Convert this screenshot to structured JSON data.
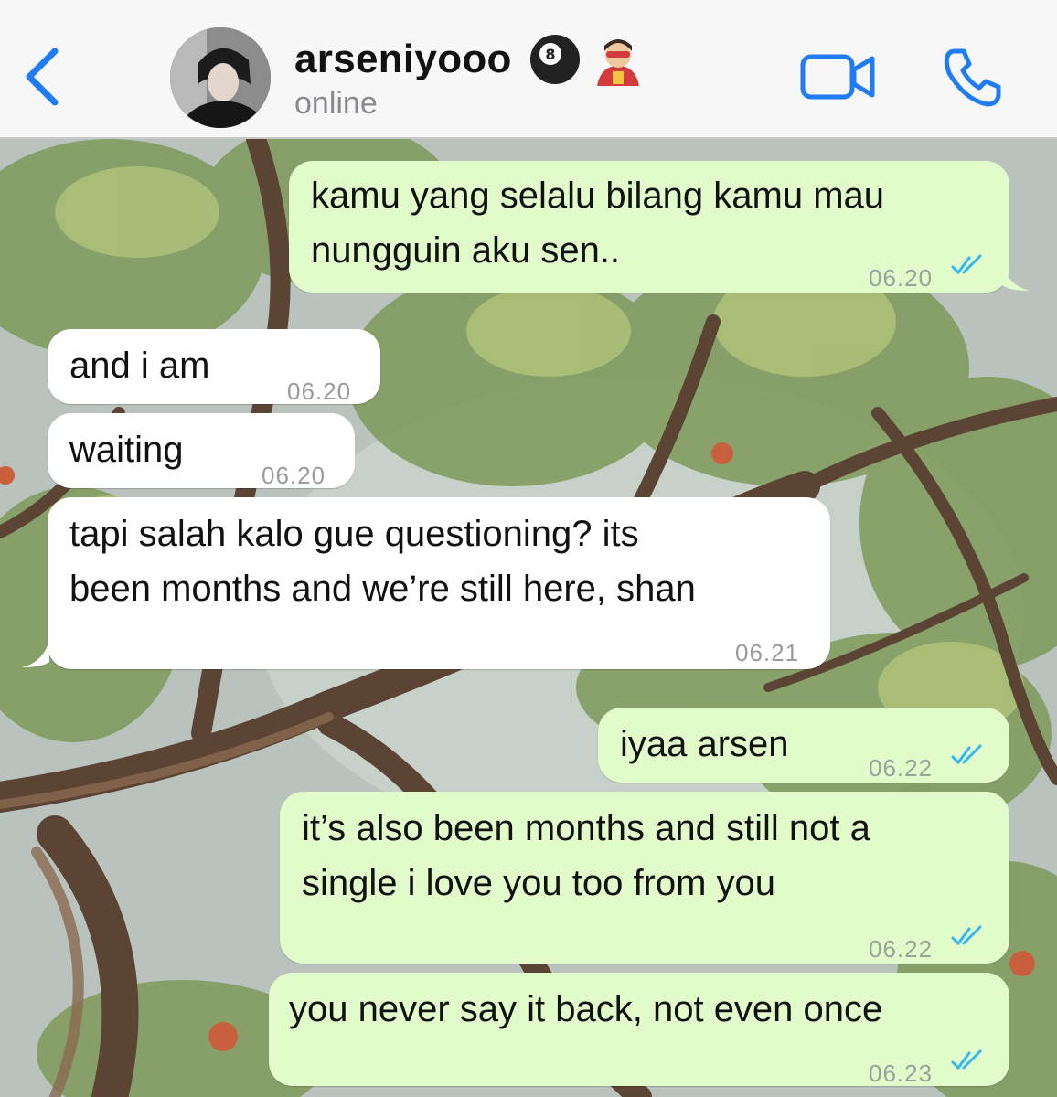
{
  "header": {
    "contact_name": "arseniyooo",
    "status": "online",
    "name_emojis": [
      "8-ball-icon",
      "superhero-icon"
    ]
  },
  "colors": {
    "accent": "#1f7cf3",
    "outgoing_bubble": "#e1fbcb",
    "incoming_bubble": "#ffffff",
    "read_ticks": "#34b7f1"
  },
  "messages": [
    {
      "direction": "out",
      "lines": [
        "kamu yang selalu bilang kamu mau",
        "nungguin aku sen.."
      ],
      "time": "06.20",
      "read": true
    },
    {
      "direction": "in",
      "lines": [
        "and i am"
      ],
      "time": "06.20"
    },
    {
      "direction": "in",
      "lines": [
        "waiting"
      ],
      "time": "06.20"
    },
    {
      "direction": "in",
      "lines": [
        "tapi salah kalo gue questioning? its",
        "been months and we’re still here, shan"
      ],
      "time": "06.21"
    },
    {
      "direction": "out",
      "lines": [
        "iyaa arsen"
      ],
      "time": "06.22",
      "read": true
    },
    {
      "direction": "out",
      "lines": [
        "it’s also been months and still not a",
        "single i love you too from you"
      ],
      "time": "06.22",
      "read": true
    },
    {
      "direction": "out",
      "lines": [
        "you never say it back, not even once"
      ],
      "time": "06.23",
      "read": true
    }
  ]
}
